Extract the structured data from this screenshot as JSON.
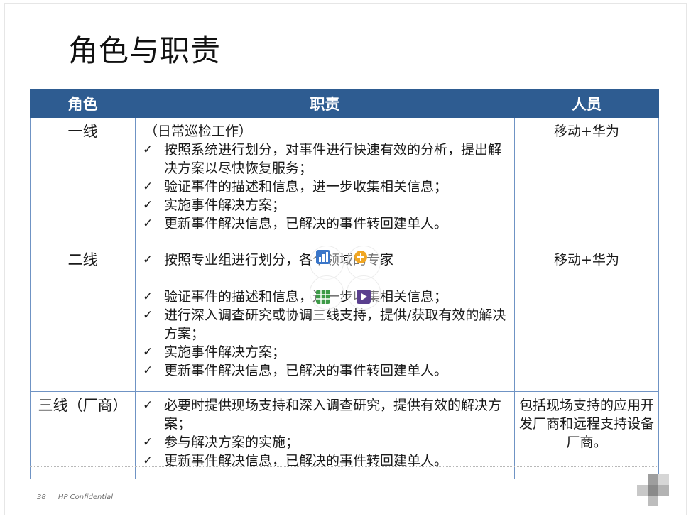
{
  "slide": {
    "title": "角色与职责",
    "footer": {
      "page_number": "38",
      "confidential": "HP Confidential"
    }
  },
  "table": {
    "headers": [
      "角色",
      "职责",
      "人员"
    ],
    "rows": [
      {
        "role": "一线",
        "intro": "（日常巡检工作）",
        "duties": [
          "按照系统进行划分，对事件进行快速有效的分析，提出解决方案以尽快恢复服务；",
          "验证事件的描述和信息，进一步收集相关信息；",
          "实施事件解决方案；",
          "更新事件解决信息，已解决的事件转回建单人。"
        ],
        "people": "移动+华为"
      },
      {
        "role": "二线",
        "duties": [
          "按照专业组进行划分，各个领域的专家",
          "验证事件的描述和信息，进一步收集相关信息；",
          "进行深入调查研究或协调三线支持，提供/获取有效的解决方案；",
          "实施事件解决方案；",
          "更新事件解决信息，已解决的事件转回建单人。"
        ],
        "people": "移动+华为"
      },
      {
        "role": "三线（厂商）",
        "duties": [
          "必要时提供现场支持和深入调查研究，提供有效的解决方案；",
          "参与解决方案的实施；",
          "更新事件解决信息，已解决的事件转回建单人。"
        ],
        "people": "包括现场支持的应用开发厂商和远程支持设备厂商。"
      }
    ]
  },
  "icons": {
    "check": "check-mark-icon",
    "placeholders": [
      "chart-icon",
      "smartart-icon",
      "table-icon",
      "media-icon"
    ]
  },
  "colors": {
    "header_bg": "#2e5c91",
    "border": "#6f93c4"
  }
}
